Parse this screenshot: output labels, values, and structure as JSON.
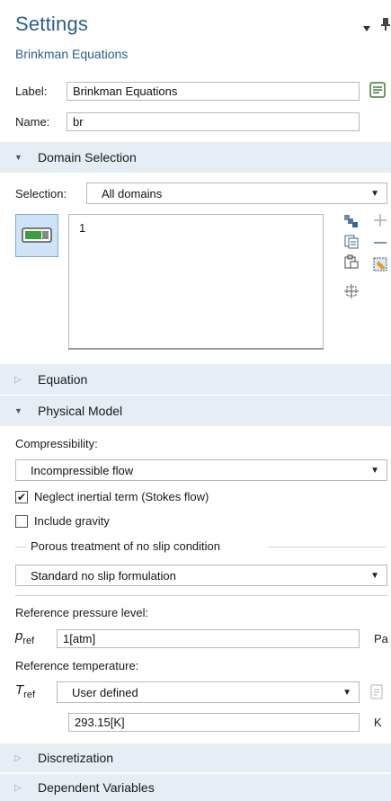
{
  "header": {
    "title": "Settings",
    "subtitle": "Brinkman Equations"
  },
  "fields": {
    "label_label": "Label:",
    "label_value": "Brinkman Equations",
    "name_label": "Name:",
    "name_value": "br"
  },
  "domain_selection": {
    "header": "Domain Selection",
    "selection_label": "Selection:",
    "selection_value": "All domains",
    "list_items": [
      "1"
    ]
  },
  "equation": {
    "header": "Equation"
  },
  "physical_model": {
    "header": "Physical Model",
    "compressibility_label": "Compressibility:",
    "compressibility_value": "Incompressible flow",
    "neglect_inertial_label": "Neglect inertial term (Stokes flow)",
    "neglect_inertial_checked": true,
    "include_gravity_label": "Include gravity",
    "include_gravity_checked": false,
    "porous_group_label": "Porous treatment of no slip condition",
    "porous_value": "Standard no slip formulation",
    "ref_pressure_label": "Reference pressure level:",
    "p_symbol": "p",
    "p_sub": "ref",
    "p_value": "1[atm]",
    "p_unit": "Pa",
    "ref_temp_label": "Reference temperature:",
    "t_symbol": "T",
    "t_sub": "ref",
    "t_mode": "User defined",
    "t_value": "293.15[K]",
    "t_unit": "K"
  },
  "discretization": {
    "header": "Discretization"
  },
  "dependent_variables": {
    "header": "Dependent Variables"
  },
  "colors": {
    "accent": "#2a5d8f",
    "section_bg": "#e6edf5",
    "active_btn": "#cfe3f7"
  }
}
